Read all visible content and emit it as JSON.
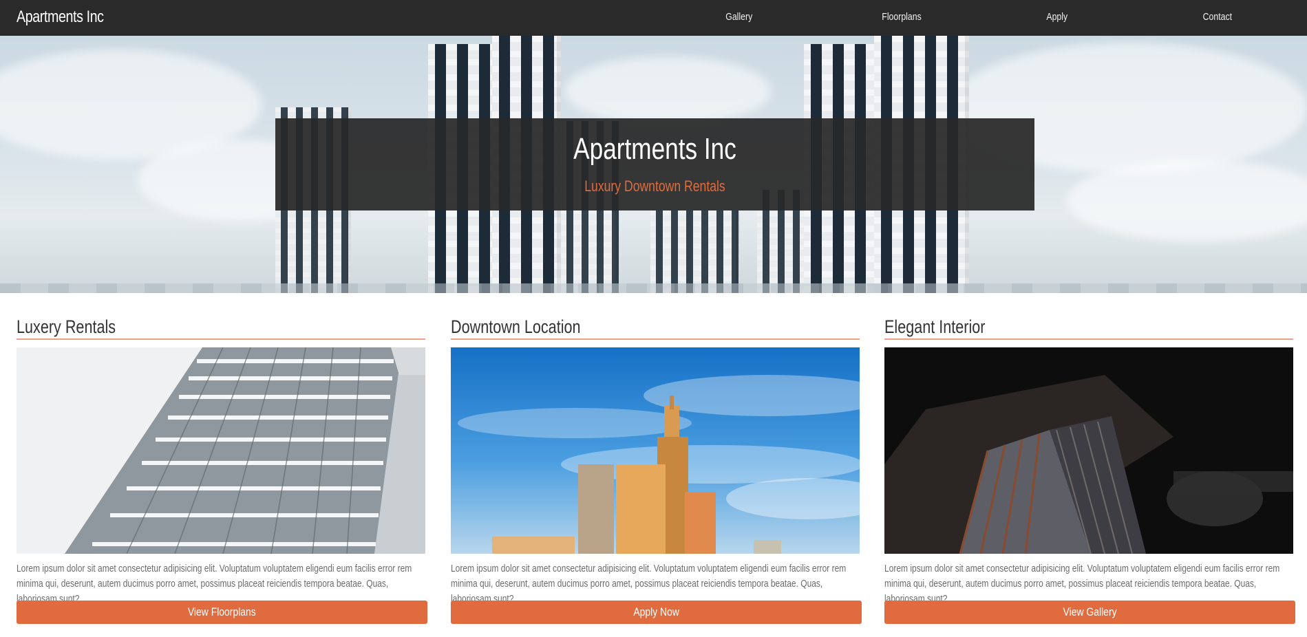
{
  "navbar": {
    "brand": "Apartments Inc",
    "links": [
      {
        "label": "Gallery"
      },
      {
        "label": "Floorplans"
      },
      {
        "label": "Apply"
      },
      {
        "label": "Contact"
      }
    ]
  },
  "hero": {
    "title": "Apartments Inc",
    "subtitle": "Luxury Downtown Rentals"
  },
  "cards": [
    {
      "heading": "Luxery Rentals",
      "image": "glass-tower-photo",
      "text": "Lorem ipsum dolor sit amet consectetur adipisicing elit. Voluptatum voluptatem eligendi eum facilis error rem minima qui, deserunt, autem ducimus porro amet, possimus placeat reiciendis tempora beatae. Quas, laboriosam sunt?",
      "button": "View Floorplans"
    },
    {
      "heading": "Downtown Location",
      "image": "downtown-skyline-photo",
      "text": "Lorem ipsum dolor sit amet consectetur adipisicing elit. Voluptatum voluptatem eligendi eum facilis error rem minima qui, deserunt, autem ducimus porro amet, possimus placeat reiciendis tempora beatae. Quas, laboriosam sunt?",
      "button": "Apply Now"
    },
    {
      "heading": "Elegant Interior",
      "image": "dark-interior-photo",
      "text": "Lorem ipsum dolor sit amet consectetur adipisicing elit. Voluptatum voluptatem eligendi eum facilis error rem minima qui, deserunt, autem ducimus porro amet, possimus placeat reiciendis tempora beatae. Quas, laboriosam sunt?",
      "button": "View Gallery"
    }
  ],
  "colors": {
    "navbar_bg": "#2a2a2a",
    "accent": "#e06b3e",
    "heading_rule": "#e8a18a",
    "body_text": "#6b6b6b"
  }
}
